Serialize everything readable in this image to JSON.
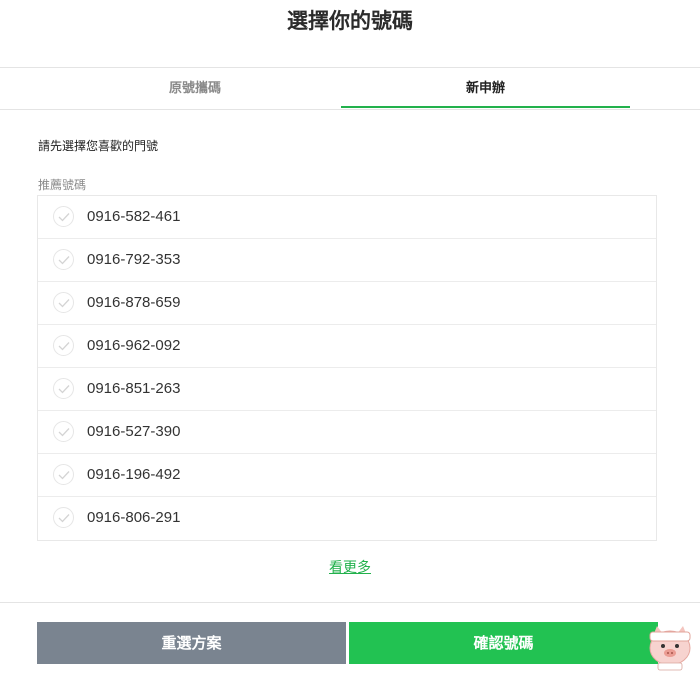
{
  "title": "選擇你的號碼",
  "tabs": [
    {
      "label": "原號攜碼"
    },
    {
      "label": "新申辦"
    }
  ],
  "instruction": "請先選擇您喜歡的門號",
  "section_label": "推薦號碼",
  "numbers": [
    "0916-582-461",
    "0916-792-353",
    "0916-878-659",
    "0916-962-092",
    "0916-851-263",
    "0916-527-390",
    "0916-196-492",
    "0916-806-291"
  ],
  "see_more": "看更多",
  "buttons": {
    "reset": "重選方案",
    "confirm": "確認號碼"
  },
  "colors": {
    "accent": "#22b14c",
    "confirm": "#22c252",
    "reset": "#7a8490"
  },
  "icons": {
    "check": "check-icon",
    "watermark": "pig-mascot-icon"
  }
}
